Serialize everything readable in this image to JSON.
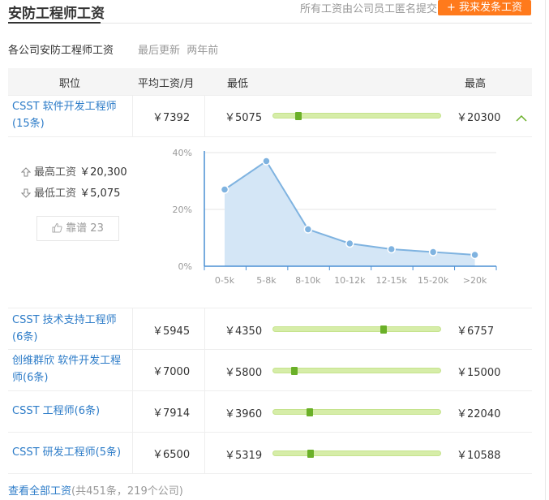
{
  "header": {
    "title": "安防工程师工资",
    "anon_note": "所有工资由公司员工匿名提交",
    "post_button": "+ 我来发条工资"
  },
  "section": {
    "subtitle": "各公司安防工程师工资",
    "updated_label": "最后更新",
    "updated_value": "两年前"
  },
  "table": {
    "headers": {
      "position": "职位",
      "avg": "平均工资/月",
      "min": "最低",
      "max": "最高"
    },
    "rows": [
      {
        "title": "CSST 软件开发工程师",
        "count": "(15条)",
        "avg": "￥7392",
        "min": "￥5075",
        "max": "￥20300",
        "avg_fraction": 0.152,
        "expanded": true
      },
      {
        "title": "CSST 技术支持工程师",
        "count": "(6条)",
        "avg": "￥5945",
        "min": "￥4350",
        "max": "￥6757",
        "avg_fraction": 0.66,
        "expanded": false
      },
      {
        "title": "创维群欣 软件开发工程",
        "count": "师(6条)",
        "avg": "￥7000",
        "min": "￥5800",
        "max": "￥15000",
        "avg_fraction": 0.13,
        "expanded": false
      },
      {
        "title": "CSST 工程师(6条)",
        "count": "",
        "avg": "￥7914",
        "min": "￥3960",
        "max": "￥22040",
        "avg_fraction": 0.22,
        "expanded": false
      },
      {
        "title": "CSST 研发工程师(5条)",
        "count": "",
        "avg": "￥6500",
        "min": "￥5319",
        "max": "￥10588",
        "avg_fraction": 0.224,
        "expanded": false
      }
    ]
  },
  "detail": {
    "highest_label": "最高工资",
    "highest_value": "￥20,300",
    "lowest_label": "最低工资",
    "lowest_value": "￥5,075",
    "like_label": "靠谱",
    "like_count": "23"
  },
  "chart_data": {
    "type": "area",
    "categories": [
      "0-5k",
      "5-8k",
      "8-10k",
      "10-12k",
      "12-15k",
      "15-20k",
      ">20k"
    ],
    "values": [
      27,
      37,
      13,
      8,
      6,
      5,
      4
    ],
    "ylim": [
      0,
      40
    ],
    "yticks": [
      "40%",
      "20%",
      "0%"
    ],
    "ytick_values": [
      40,
      20,
      0
    ],
    "grid": true,
    "colors": {
      "line": "#7fb3e0",
      "fill": "#d4e6f6",
      "point": "#7fb3e0",
      "axis": "#4a8fd4"
    }
  },
  "footer": {
    "all_link": "查看全部工资",
    "summary": "(共451条，219个公司)"
  },
  "colors": {
    "accent": "#ff7a1c",
    "link": "#2d7cc8",
    "range_marker": "#6ab028",
    "range_track": "#d6eda8"
  }
}
